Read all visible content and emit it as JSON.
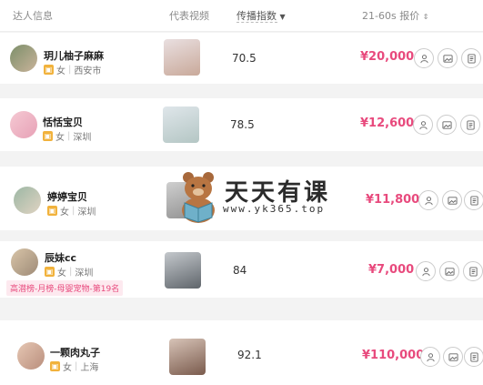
{
  "header": {
    "col_name": "达人信息",
    "col_video": "代表视频",
    "col_index": "传播指数",
    "col_price": "21-60s 报价"
  },
  "rows": [
    {
      "name": "玥儿柚子麻麻",
      "gender": "女",
      "city": "西安市",
      "score": "70.5",
      "price": "¥20,000"
    },
    {
      "name": "恬恬宝贝",
      "gender": "女",
      "city": "深圳",
      "score": "78.5",
      "price": "¥12,600"
    },
    {
      "name": "婷婷宝贝",
      "gender": "女",
      "city": "深圳",
      "score": "",
      "price": "¥11,800"
    },
    {
      "name": "辰妹cc",
      "gender": "女",
      "city": "深圳",
      "score": "84",
      "price": "¥7,000",
      "tag": "高潜榜-月榜-母婴宠物-第19名"
    },
    {
      "name": "一颗肉丸子",
      "gender": "女",
      "city": "上海",
      "score": "92.1",
      "price": "¥110,000"
    }
  ],
  "watermark": {
    "title": "天天有课",
    "url": "www.yk365.top"
  },
  "colors": {
    "price": "#e84a7d",
    "badge": "#f1b23c"
  },
  "icons": [
    "user-icon",
    "image-icon",
    "document-icon"
  ]
}
